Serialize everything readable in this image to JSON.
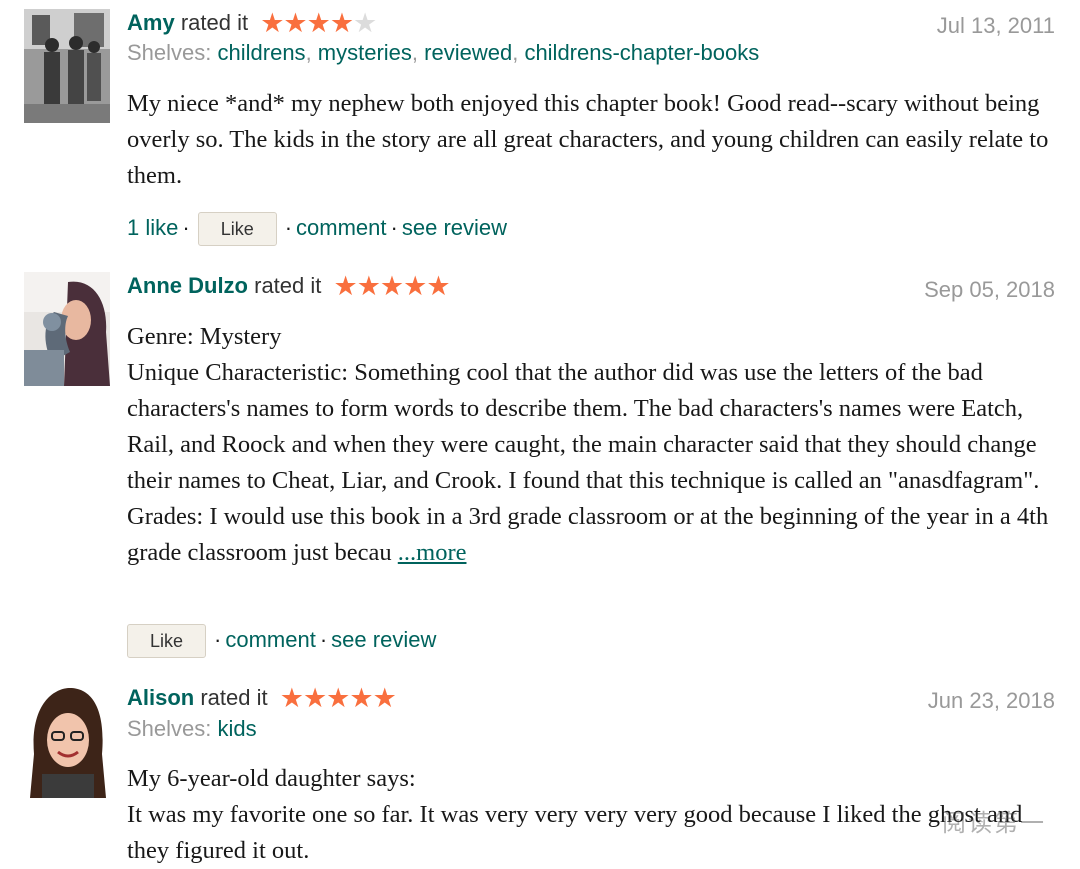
{
  "reviews": [
    {
      "name": "Amy",
      "rated_text": "rated it",
      "stars_on": "★★★★",
      "stars_off": "★",
      "rating": 4,
      "date": "Jul 13, 2011",
      "shelves_label": "Shelves:",
      "shelves": [
        "childrens",
        "mysteries",
        "reviewed",
        "childrens-chapter-books"
      ],
      "body": [
        "My niece *and* my nephew both enjoyed this chapter book! Good read--scary without being overly so. The kids in the story are all great characters, and young children can easily relate to them."
      ],
      "likes": "1 like",
      "like_button": "Like",
      "comment": "comment",
      "see_review": "see review"
    },
    {
      "name": "Anne Dulzo",
      "rated_text": "rated it",
      "stars_on": "★★★★★",
      "stars_off": "",
      "rating": 5,
      "date": "Sep 05, 2018",
      "body": [
        "Genre: Mystery",
        "Unique Characteristic: Something cool that the author did was use the letters of the bad characters's names to form words to describe them. The bad characters's names were Eatch, Rail, and Roock and when they were caught, the main character said that they should change their names to Cheat, Liar, and Crook. I found that this technique is called an \"anasdfagram\".",
        "Grades: I would use this book in a 3rd grade classroom or at the beginning of the year in a 4th grade classroom just becau"
      ],
      "more": "...more",
      "like_button": "Like",
      "comment": "comment",
      "see_review": "see review"
    },
    {
      "name": "Alison",
      "rated_text": "rated it",
      "stars_on": "★★★★★",
      "stars_off": "",
      "rating": 5,
      "date": "Jun 23, 2018",
      "shelves_label": "Shelves:",
      "shelves": [
        "kids"
      ],
      "body": [
        "My 6-year-old daughter says:",
        "It was my favorite one so far. It was very very very very good because I liked the ghost and they figured it out."
      ]
    }
  ],
  "watermark": "阅读第一"
}
